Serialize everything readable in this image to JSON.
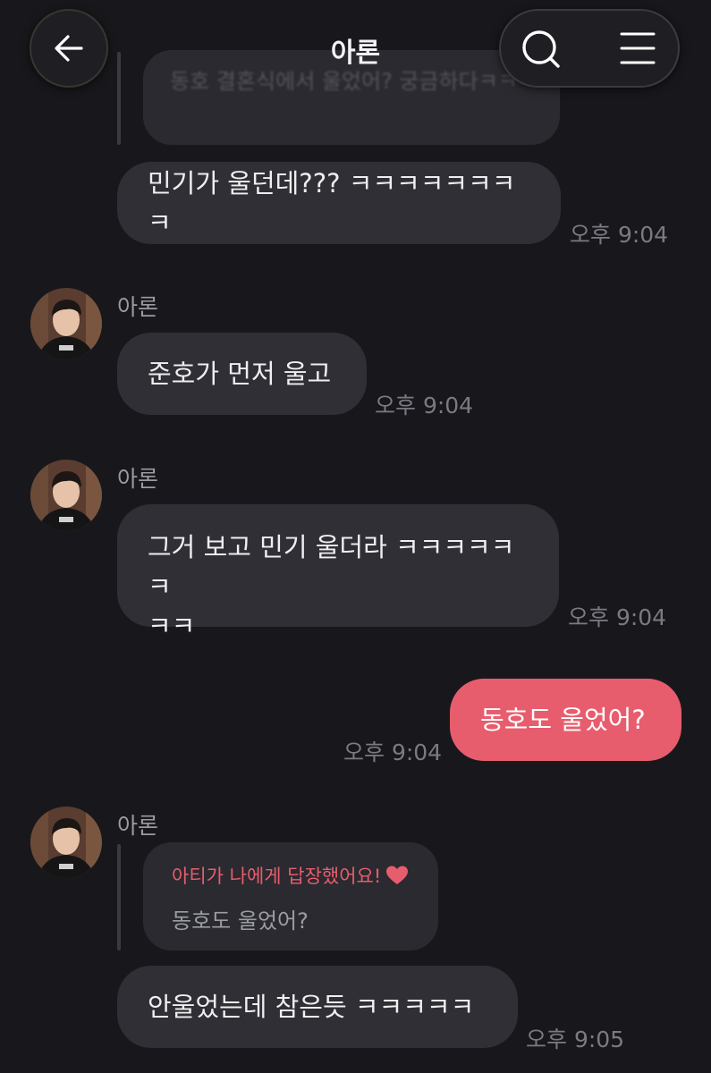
{
  "header": {
    "title": "아론",
    "back_icon": "arrow-left-icon",
    "search_icon": "search-icon",
    "menu_icon": "hamburger-menu-icon"
  },
  "messages": {
    "quoted_top": "동호 결혼식에서 울었어? 궁금하다ㅋㅋ",
    "m1": {
      "text": "민기가 울던데??? ㅋㅋㅋㅋㅋㅋㅋㅋ",
      "time": "오후 9:04"
    },
    "m2": {
      "sender": "아론",
      "text": "준호가 먼저 울고",
      "time": "오후 9:04"
    },
    "m3": {
      "sender": "아론",
      "text_line1": "그거 보고 민기 울더라 ㅋㅋㅋㅋㅋㅋ",
      "text_line2": "ㅋㅋ",
      "time": "오후 9:04"
    },
    "m4": {
      "text": "동호도 울었어?",
      "time": "오후 9:04"
    },
    "m5": {
      "sender": "아론",
      "reply_title": "아티가 나에게 답장했어요!",
      "reply_quote": "동호도 울었어?",
      "text": "안울었는데 참은듯 ㅋㅋㅋㅋㅋ",
      "time": "오후 9:05"
    }
  },
  "colors": {
    "background": "#18181c",
    "bubble_incoming": "#2f2f35",
    "bubble_outgoing": "#e85d6d",
    "accent": "#e85d6d"
  }
}
